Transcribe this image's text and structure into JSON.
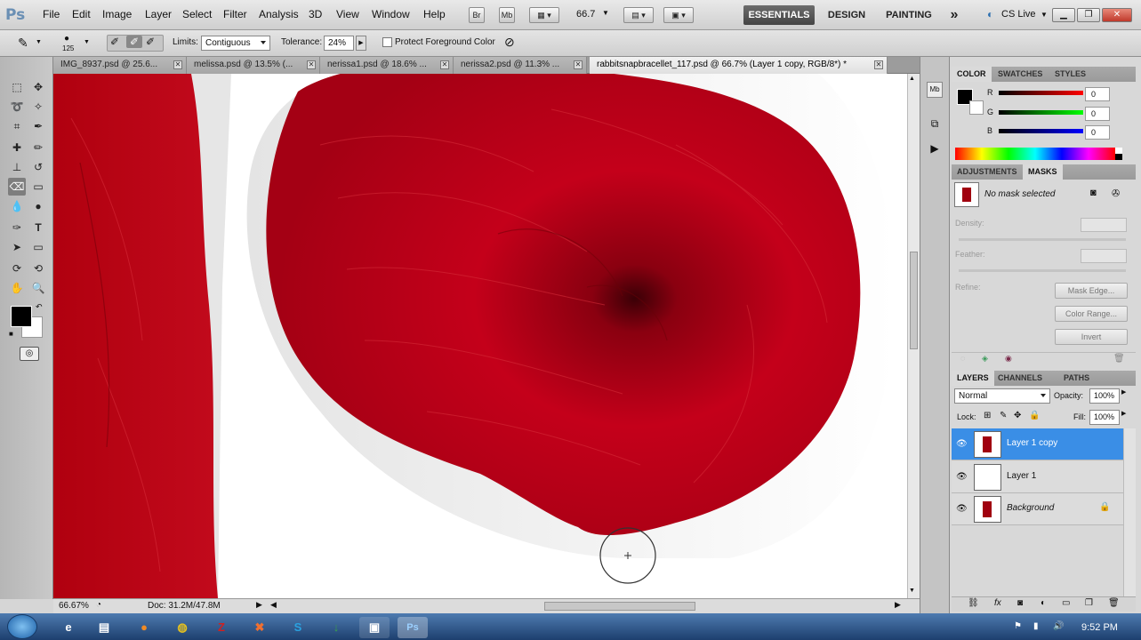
{
  "app": {
    "logo": "Ps"
  },
  "menu": [
    "File",
    "Edit",
    "Image",
    "Layer",
    "Select",
    "Filter",
    "Analysis",
    "3D",
    "View",
    "Window",
    "Help"
  ],
  "menubar": {
    "br": "Br",
    "mb": "Mb",
    "zoom": "66.7",
    "workspaces": [
      "ESSENTIALS",
      "DESIGN",
      "PAINTING"
    ],
    "more": "»",
    "cs_live": "CS Live"
  },
  "options": {
    "brush_size": "125",
    "limits_label": "Limits:",
    "limits_value": "Contiguous",
    "tolerance_label": "Tolerance:",
    "tolerance_value": "24%",
    "protect_label": "Protect Foreground Color"
  },
  "tabs": [
    "IMG_8937.psd @ 25.6...",
    "melissa.psd @ 13.5% (...",
    "nerissa1.psd @ 18.6% ...",
    "nerissa2.psd @ 11.3% ...",
    "rabbitsnapbracellet_117.psd @ 66.7% (Layer 1 copy, RGB/8*) *"
  ],
  "status": {
    "zoom": "66.67%",
    "doc": "Doc: 31.2M/47.8M"
  },
  "color_panel": {
    "tabs": [
      "COLOR",
      "SWATCHES",
      "STYLES"
    ],
    "r_label": "R",
    "g_label": "G",
    "b_label": "B",
    "r": "0",
    "g": "0",
    "b": "0"
  },
  "masks_panel": {
    "tabs": [
      "ADJUSTMENTS",
      "MASKS"
    ],
    "no_mask": "No mask selected",
    "density": "Density:",
    "feather": "Feather:",
    "refine": "Refine:",
    "mask_edge": "Mask Edge...",
    "color_range": "Color Range...",
    "invert": "Invert"
  },
  "layers_panel": {
    "tabs": [
      "LAYERS",
      "CHANNELS",
      "PATHS"
    ],
    "blend": "Normal",
    "opacity_label": "Opacity:",
    "opacity": "100%",
    "lock_label": "Lock:",
    "fill_label": "Fill:",
    "fill": "100%",
    "layers": [
      {
        "name": "Layer 1 copy",
        "selected": true
      },
      {
        "name": "Layer 1",
        "selected": false
      },
      {
        "name": "Background",
        "selected": false
      }
    ]
  },
  "taskbar": {
    "time": "9:52 PM"
  },
  "colors": {
    "fur": "#b5000f",
    "selected_layer": "#3a8ee6",
    "taskbar": "#2a5590"
  }
}
